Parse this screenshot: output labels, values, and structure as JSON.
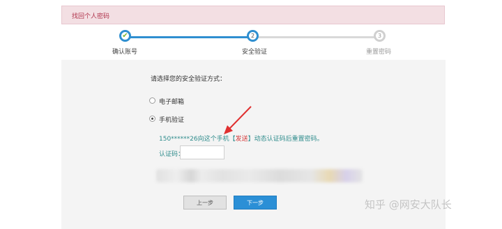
{
  "header": {
    "title": "找回个人密码"
  },
  "progress": {
    "steps": [
      {
        "label": "确认账号",
        "number": "",
        "status": "done"
      },
      {
        "label": "安全验证",
        "number": "2",
        "status": "current"
      },
      {
        "label": "重置密码",
        "number": "3",
        "status": "pending"
      }
    ],
    "check_glyph": "✔"
  },
  "form": {
    "prompt": "请选择您的安全验证方式：",
    "options": [
      {
        "label": "电子邮箱",
        "selected": false
      },
      {
        "label": "手机验证",
        "selected": true
      }
    ],
    "hint_prefix": "150******26向这个手机【",
    "send_link": "发送",
    "hint_suffix": "】动态认证码后重置密码。",
    "code_label": "认证码：",
    "code_value": ""
  },
  "buttons": {
    "prev_label": "上一步",
    "next_label": "下一步"
  },
  "watermark": "知乎 @网安大队长",
  "colors": {
    "accent": "#2f8fd0",
    "banner_bg": "#f3dfe3",
    "banner_text": "#b0344c",
    "hint": "#2e8c8c",
    "link": "#d43b3b",
    "arrow": "#e03030"
  },
  "icons": {
    "step1": "check-icon",
    "annotation": "red-arrow-icon"
  }
}
